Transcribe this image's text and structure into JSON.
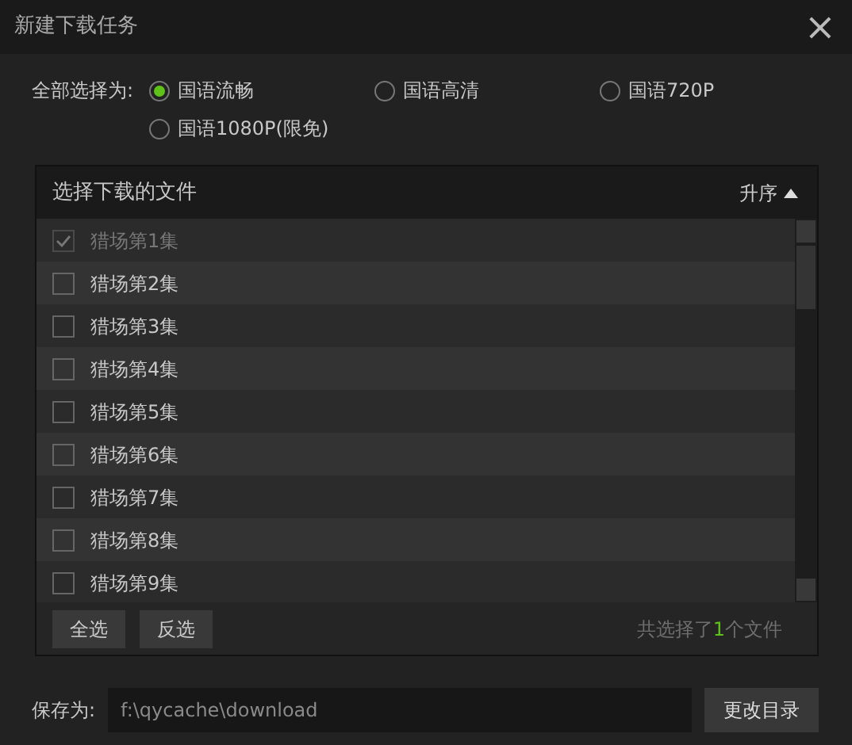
{
  "window": {
    "title": "新建下载任务",
    "close": "×"
  },
  "quality": {
    "label": "全部选择为:",
    "options": [
      {
        "label": "国语流畅",
        "selected": true
      },
      {
        "label": "国语高清",
        "selected": false
      },
      {
        "label": "国语720P",
        "selected": false
      },
      {
        "label": "国语1080P(限免)",
        "selected": false
      }
    ]
  },
  "files": {
    "title": "选择下载的文件",
    "sort": "升序",
    "items": [
      {
        "name": "猎场第1集",
        "checked": true,
        "disabled": true
      },
      {
        "name": "猎场第2集",
        "checked": false,
        "disabled": false
      },
      {
        "name": "猎场第3集",
        "checked": false,
        "disabled": false
      },
      {
        "name": "猎场第4集",
        "checked": false,
        "disabled": false
      },
      {
        "name": "猎场第5集",
        "checked": false,
        "disabled": false
      },
      {
        "name": "猎场第6集",
        "checked": false,
        "disabled": false
      },
      {
        "name": "猎场第7集",
        "checked": false,
        "disabled": false
      },
      {
        "name": "猎场第8集",
        "checked": false,
        "disabled": false
      },
      {
        "name": "猎场第9集",
        "checked": false,
        "disabled": false
      }
    ],
    "buttons": [
      "全选",
      "反选"
    ],
    "summary": {
      "prefix": "共选择了",
      "count": "1",
      "suffix": "个文件"
    }
  },
  "save": {
    "label": "保存为:",
    "path": "f:\\qycache\\download",
    "button": "更改目录"
  }
}
